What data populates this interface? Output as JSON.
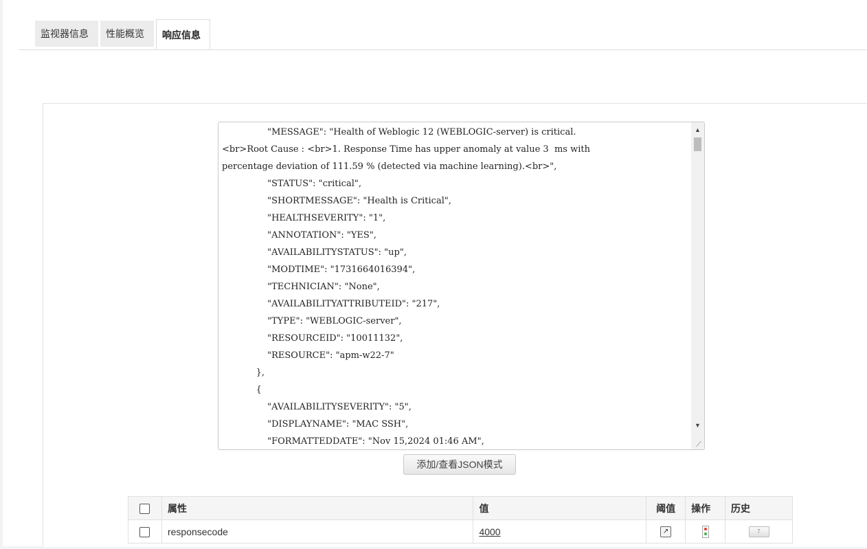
{
  "tabs": [
    {
      "label": "监视器信息"
    },
    {
      "label": "性能概览"
    },
    {
      "label": "响应信息",
      "active": true
    }
  ],
  "json_response": {
    "lines": [
      "                \"MESSAGE\": \"Health of Weblogic 12 (WEBLOGIC-server) is critical.",
      "<br>Root Cause : <br>1. Response Time has upper anomaly at value 3  ms with",
      "percentage deviation of 111.59 % (detected via machine learning).<br>\",",
      "                \"STATUS\": \"critical\",",
      "                \"SHORTMESSAGE\": \"Health is Critical\",",
      "                \"HEALTHSEVERITY\": \"1\",",
      "                \"ANNOTATION\": \"YES\",",
      "                \"AVAILABILITYSTATUS\": \"up\",",
      "                \"MODTIME\": \"1731664016394\",",
      "                \"TECHNICIAN\": \"None\",",
      "                \"AVAILABILITYATTRIBUTEID\": \"217\",",
      "                \"TYPE\": \"WEBLOGIC-server\",",
      "                \"RESOURCEID\": \"10011132\",",
      "                \"RESOURCE\": \"apm-w22-7\"",
      "            },",
      "            {",
      "                \"AVAILABILITYSEVERITY\": \"5\",",
      "                \"DISPLAYNAME\": \"MAC SSH\",",
      "                \"FORMATTEDDATE\": \"Nov 15,2024 01:46 AM\","
    ]
  },
  "json_mode_button": "添加/查看JSON模式",
  "table": {
    "headers": {
      "attribute": "属性",
      "value": "值",
      "threshold": "阈值",
      "action": "操作",
      "history": "历史"
    },
    "rows": [
      {
        "attribute": "responsecode",
        "value": "4000"
      }
    ]
  },
  "colors": {
    "page_bg": "#f3f3f3",
    "tab_inactive_bg": "#ececec",
    "table_header_bg": "#f5f5f5",
    "status_red": "#e23a2a",
    "status_green": "#39b54a"
  }
}
